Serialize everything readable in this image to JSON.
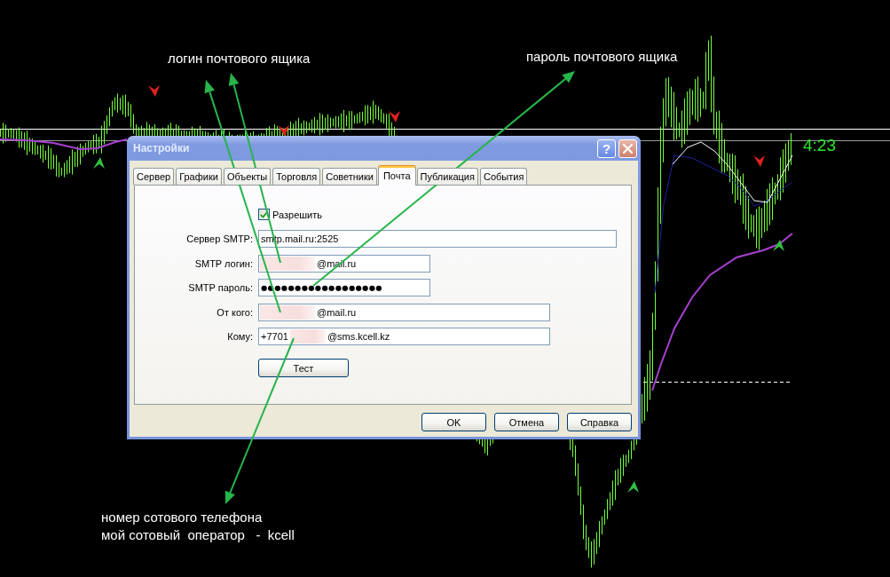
{
  "chart": {
    "countdown": "4:23"
  },
  "annotations": [
    {
      "lines": [
        "логин почтового ящика"
      ]
    },
    {
      "lines": [
        "пароль почтового ящика"
      ]
    },
    {
      "lines": [
        "номер сотового телефона",
        "мой сотовый  оператор   -  kcell"
      ]
    }
  ],
  "window": {
    "title": "Настройки",
    "help_button": "?"
  },
  "tabs": [
    {
      "label": "Сервер",
      "selected": false
    },
    {
      "label": "Графики",
      "selected": false
    },
    {
      "label": "Объекты",
      "selected": false
    },
    {
      "label": "Торговля",
      "selected": false
    },
    {
      "label": "Советники",
      "selected": false
    },
    {
      "label": "Почта",
      "selected": true
    },
    {
      "label": "Публикация",
      "selected": false
    },
    {
      "label": "События",
      "selected": false
    }
  ],
  "enable": {
    "label": "Разрешить",
    "checked": true
  },
  "fields": [
    {
      "label": "Сервер SMTP:",
      "kind": "text",
      "segments": [
        {
          "kind": "text",
          "text": "smtp.mail.ru:2525"
        }
      ]
    },
    {
      "label": "SMTP логин:",
      "kind": "text",
      "segments": [
        {
          "kind": "redacted"
        },
        {
          "kind": "text",
          "text": "@mail.ru"
        }
      ]
    },
    {
      "label": "SMTP пароль:",
      "kind": "password",
      "segments": [
        {
          "kind": "text",
          "text": "●●●●●●●●●●●●●●●●●●"
        }
      ]
    },
    {
      "label": "От кого:",
      "kind": "text",
      "segments": [
        {
          "kind": "redacted"
        },
        {
          "kind": "text",
          "text": "@mail.ru"
        }
      ]
    },
    {
      "label": "Кому:",
      "kind": "text",
      "segments": [
        {
          "kind": "text",
          "text": "+7701"
        },
        {
          "kind": "redacted"
        },
        {
          "kind": "text",
          "text": "@sms.kcell.kz"
        }
      ]
    }
  ],
  "test_button": "Тест",
  "buttons": [
    "OK",
    "Отмена",
    "Справка"
  ]
}
